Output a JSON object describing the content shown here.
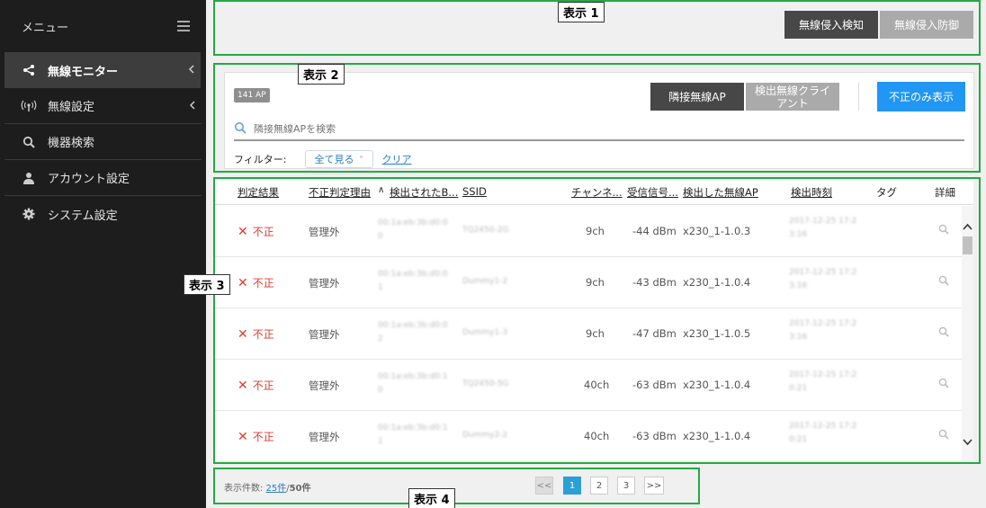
{
  "sidebar": {
    "title": "メニュー",
    "items": [
      {
        "label": "無線モニター",
        "icon": "share-icon",
        "active": true,
        "has_chevron": true
      },
      {
        "label": "無線設定",
        "icon": "antenna-icon",
        "active": false,
        "has_chevron": true
      },
      {
        "label": "機器検索",
        "icon": "search-icon",
        "active": false,
        "has_chevron": false
      },
      {
        "label": "アカウント設定",
        "icon": "user-icon",
        "active": false,
        "has_chevron": false
      },
      {
        "label": "システム設定",
        "icon": "gear-icon",
        "active": false,
        "has_chevron": false
      }
    ]
  },
  "callouts": {
    "c1": "表示 1",
    "c2": "表示 2",
    "c3": "表示 3",
    "c4": "表示 4"
  },
  "top_tabs": {
    "detect": "無線侵入検知",
    "prevent": "無線侵入防御"
  },
  "panel2": {
    "badge": "141 AP",
    "tab_neighbor": "隣接無線AP",
    "tab_clients": "検出無線クライアント",
    "only_invalid_button": "不正のみ表示",
    "search_placeholder": "隣接無線APを検索",
    "filter_label": "フィルター:",
    "filter_select": "全て見る",
    "clear_link": "クリア"
  },
  "table": {
    "headers": {
      "judgement": "判定結果",
      "reason": "不正判定理由",
      "sort_marker": "∧",
      "bssid": "検出されたB...",
      "ssid": "SSID",
      "channel": "チャンネ...",
      "signal": "受信信号...",
      "detected_ap": "検出した無線AP",
      "time": "検出時刻",
      "tag": "タグ",
      "detail": "詳細"
    },
    "rows": [
      {
        "judgement": "不正",
        "reason": "管理外",
        "bssid": "00:1a:eb:3b:d0:0",
        "bssid2": "0",
        "ssid": "TQ2450-2G",
        "channel": "9ch",
        "signal": "-44 dBm",
        "ap": "x230_1-1.0.3",
        "time": "2017-12-25 17:2",
        "time2": "3:16"
      },
      {
        "judgement": "不正",
        "reason": "管理外",
        "bssid": "00:1a:eb:3b:d0:0",
        "bssid2": "1",
        "ssid": "Dummy1-2",
        "channel": "9ch",
        "signal": "-43 dBm",
        "ap": "x230_1-1.0.4",
        "time": "2017-12-25 17:2",
        "time2": "3:16"
      },
      {
        "judgement": "不正",
        "reason": "管理外",
        "bssid": "00:1a:eb:3b:d0:0",
        "bssid2": "2",
        "ssid": "Dummy1-3",
        "channel": "9ch",
        "signal": "-47 dBm",
        "ap": "x230_1-1.0.5",
        "time": "2017-12-25 17:2",
        "time2": "3:16"
      },
      {
        "judgement": "不正",
        "reason": "管理外",
        "bssid": "00:1a:eb:3b:d0:1",
        "bssid2": "0",
        "ssid": "TQ2450-5G",
        "channel": "40ch",
        "signal": "-63 dBm",
        "ap": "x230_1-1.0.4",
        "time": "2017-12-25 17:2",
        "time2": "0:21"
      },
      {
        "judgement": "不正",
        "reason": "管理外",
        "bssid": "00:1a:eb:3b:d0:1",
        "bssid2": "1",
        "ssid": "Dummy2-2",
        "channel": "40ch",
        "signal": "-63 dBm",
        "ap": "x230_1-1.0.4",
        "time": "2017-12-25 17:2",
        "time2": "0:21"
      }
    ]
  },
  "pager": {
    "label": "表示件数:",
    "per_page": "25件",
    "sep": "/",
    "total": "50件",
    "first": "<<",
    "pages": [
      "1",
      "2",
      "3"
    ],
    "last": ">>"
  },
  "colors": {
    "accent_blue": "#2196f3",
    "invalid_red": "#e23b2f",
    "highlight_green": "#22aa44",
    "sidebar_bg": "#1d1d1d"
  }
}
